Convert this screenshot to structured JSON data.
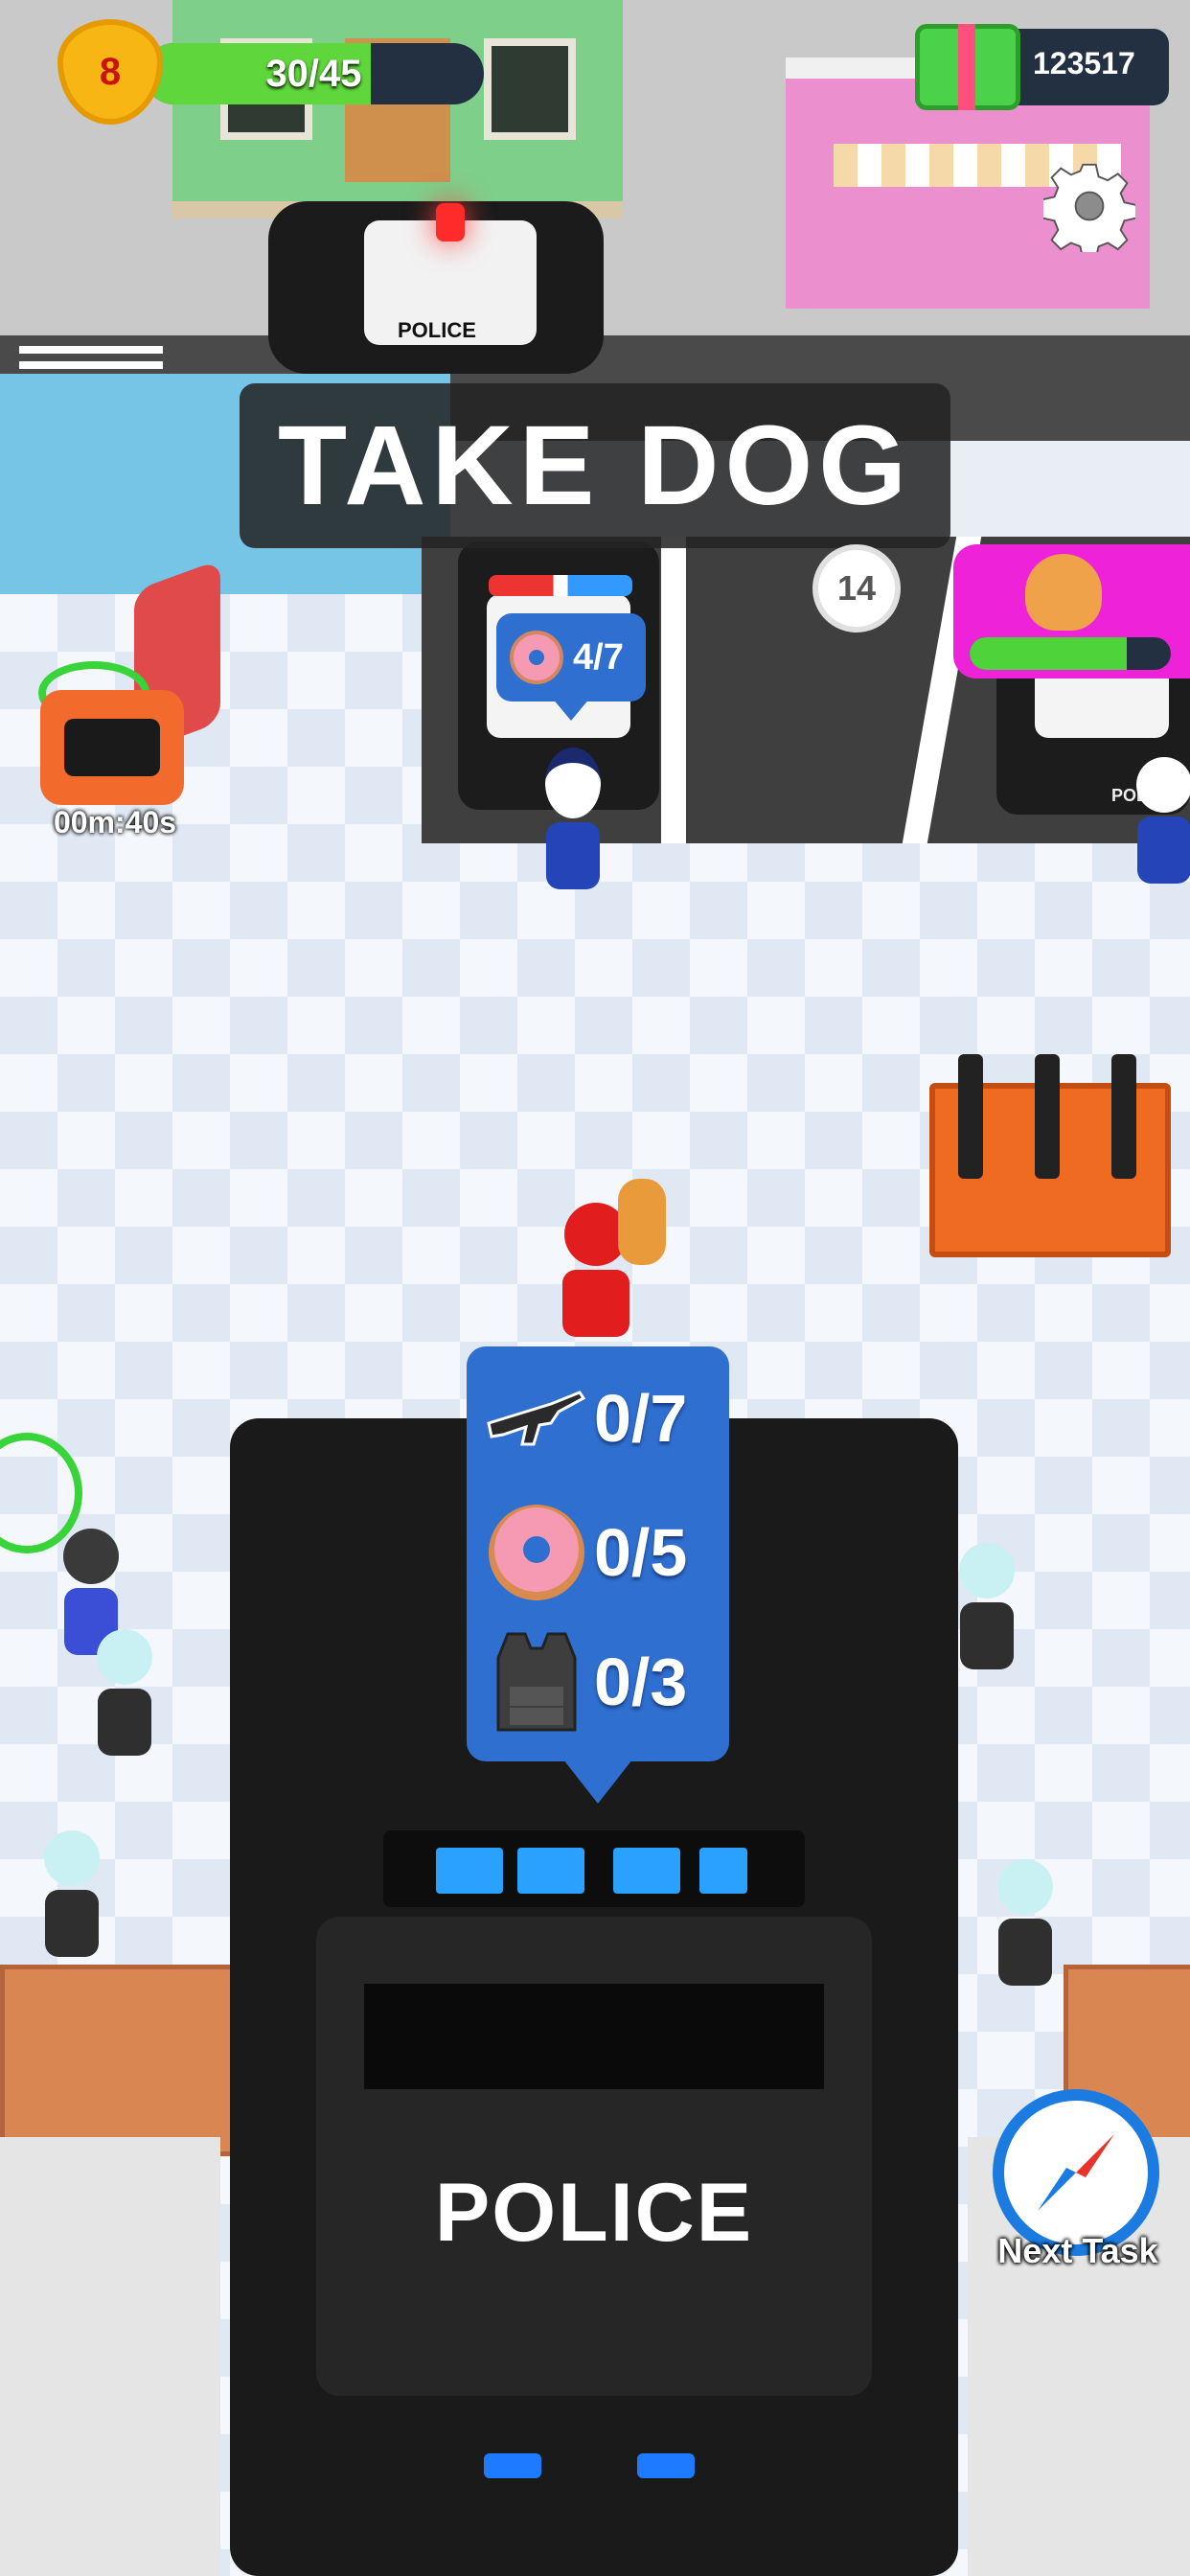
{
  "hud": {
    "level": "8",
    "xp_text": "30/45",
    "xp_progress": 0.667,
    "cash": "123517",
    "settings_icon": "gear-icon"
  },
  "banner": {
    "text": "TAKE DOG"
  },
  "timer": {
    "text": "00m:40s",
    "icon": "swat-truck-icon"
  },
  "counter": {
    "value": "14"
  },
  "dog_upgrade": {
    "icon": "police-dog-icon",
    "progress": 0.78
  },
  "car_order": {
    "icon": "donut-icon",
    "text": "4/7"
  },
  "truck_order": {
    "items": [
      {
        "icon": "rifle-icon",
        "text": "0/7"
      },
      {
        "icon": "donut-icon",
        "text": "0/5"
      },
      {
        "icon": "vest-icon",
        "text": "0/3"
      }
    ]
  },
  "scene": {
    "top_car_label": "POLICE",
    "lot_car_label": "POLICE",
    "truck_label": "POLICE"
  },
  "next_task": {
    "label": "Next Task",
    "icon": "compass-icon"
  },
  "colors": {
    "accent_blue": "#2f6fd0",
    "xp_green": "#5fd63c",
    "dog_card_magenta": "#ee22d8",
    "timer_orange": "#f26a2c"
  }
}
